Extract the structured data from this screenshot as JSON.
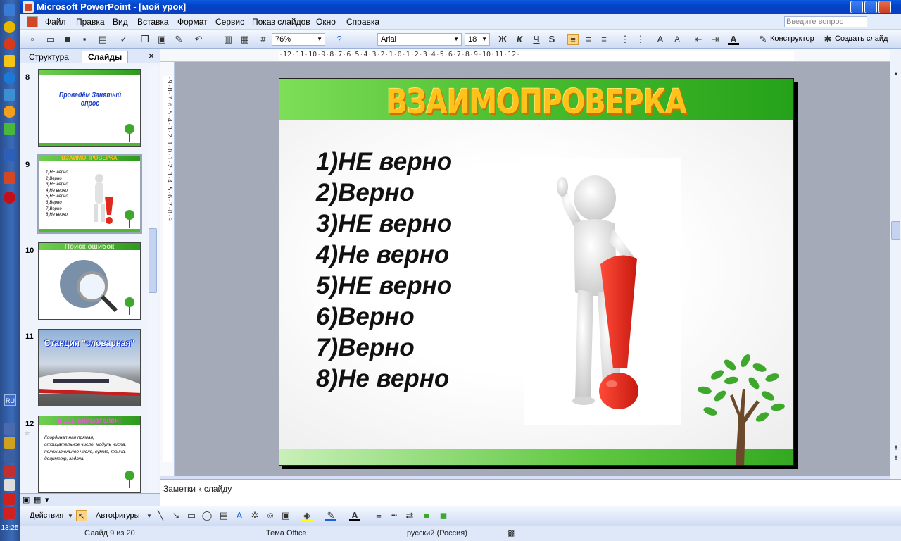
{
  "window": {
    "title": "Microsoft PowerPoint - [мой урок]"
  },
  "menu": {
    "items": [
      "Файл",
      "Правка",
      "Вид",
      "Вставка",
      "Формат",
      "Сервис",
      "Показ слайдов",
      "Окно",
      "Справка"
    ],
    "ask_placeholder": "Введите вопрос"
  },
  "toolbar": {
    "zoom": "76%",
    "font": "Arial",
    "font_size": "18",
    "bold": "Ж",
    "italic": "К",
    "underline": "Ч",
    "shadow": "S",
    "designer": "Конструктор",
    "new_slide": "Создать слайд"
  },
  "ruler": {
    "horizontal": "·12·11·10·9·8·7·6·5·4·3·2·1·0·1·2·3·4·5·6·7·8·9·10·11·12·",
    "vertical": "·9·8·7·6·5·4·3·2·1·0·1·2·3·4·5·6·7·8·9·"
  },
  "panel": {
    "tabs": [
      "Структура",
      "Слайды"
    ],
    "slides": [
      {
        "num": "8",
        "title": "Проведём Занятый опрос"
      },
      {
        "num": "9",
        "title": "ВЗАИМОПРОВЕРКА",
        "lines": [
          "1)НЕ верно",
          "2)Верно",
          "3)НЕ верно",
          "4)Не верно",
          "5)НЕ верно",
          "6)Верно",
          "7)Верно",
          "8)Не верно"
        ]
      },
      {
        "num": "10",
        "title": "Поиск ошибок"
      },
      {
        "num": "11",
        "title": "Станция \"словарная\""
      },
      {
        "num": "12",
        "title": "Будь внимателен!",
        "text": "Координатная прямая, отрицательное число, модуль числа, положительное число, сумма, тонна, дециметр, задача."
      }
    ]
  },
  "slide": {
    "title": "ВЗАИМОПРОВЕРКА",
    "answers": [
      "1)НЕ верно",
      "2)Верно",
      "3)НЕ верно",
      "4)Не верно",
      "5)НЕ верно",
      "6)Верно",
      "7)Верно",
      "8)Не верно"
    ]
  },
  "notes": {
    "placeholder": "Заметки к слайду"
  },
  "drawbar": {
    "actions": "Действия",
    "autoshapes": "Автофигуры"
  },
  "status": {
    "slide": "Слайд 9 из 20",
    "theme": "Тема Office",
    "language": "русский (Россия)"
  },
  "taskbar": {
    "time": "13:25",
    "lang": "RU"
  },
  "colors": {
    "title_fill": "#ffc21a",
    "green_band": "#4cbe30",
    "exclamation": "#e0281c"
  }
}
